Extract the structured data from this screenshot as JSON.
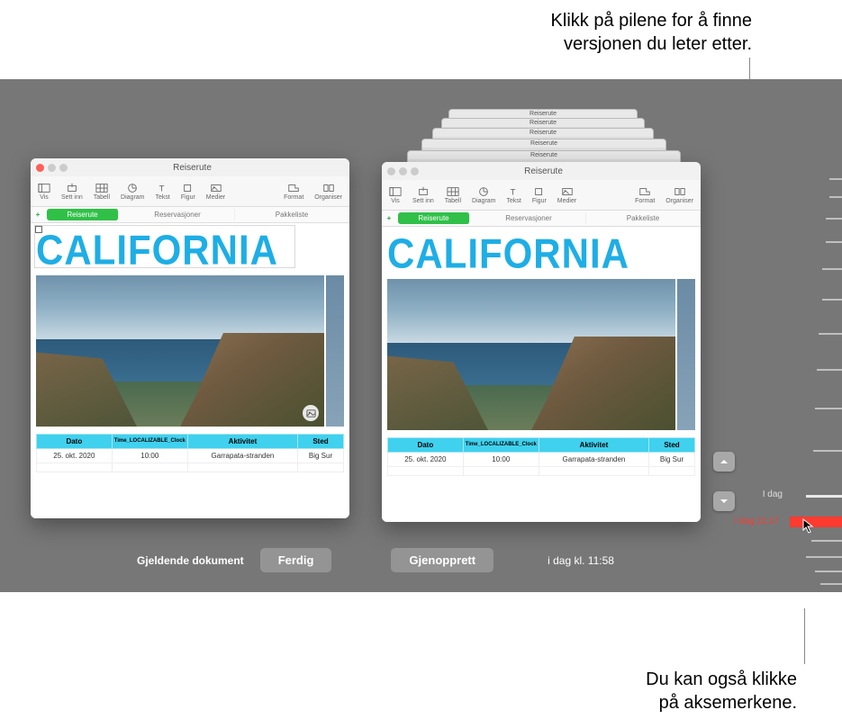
{
  "callouts": {
    "top_line1": "Klikk på pilene for å finne",
    "top_line2": "versjonen du leter etter.",
    "bottom_line1": "Du kan også klikke",
    "bottom_line2": "på aksemerkene."
  },
  "window": {
    "title": "Reiserute",
    "toolbar": {
      "vis": "Vis",
      "settinn": "Sett inn",
      "tabell": "Tabell",
      "diagram": "Diagram",
      "tekst": "Tekst",
      "figur": "Figur",
      "medier": "Medier",
      "format": "Format",
      "organiser": "Organiser"
    },
    "tabs": {
      "add": "+",
      "reiserute": "Reiserute",
      "reservasjoner": "Reservasjoner",
      "pakkeliste": "Pakkeliste"
    },
    "heading": "CALIFORNIA",
    "table": {
      "headers": {
        "dato": "Dato",
        "time": "Time_LOCALIZABLE_Clock",
        "aktivitet": "Aktivitet",
        "sted": "Sted"
      },
      "row": {
        "dato": "25. okt. 2020",
        "time": "10:00",
        "aktivitet": "Garrapata-stranden",
        "sted": "Big Sur"
      }
    }
  },
  "footer": {
    "current_doc": "Gjeldende dokument",
    "ferdig": "Ferdig",
    "gjenopprett": "Gjenopprett",
    "version_time": "i dag kl. 11:58"
  },
  "timeline": {
    "today": "I dag",
    "current": "I dag 11:17"
  }
}
